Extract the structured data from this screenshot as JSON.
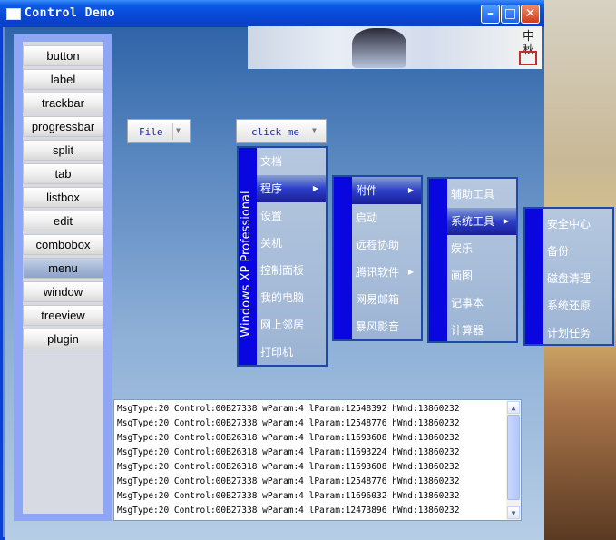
{
  "window": {
    "title": "Control Demo",
    "minimize": "–",
    "maximize": "□",
    "close": "✕"
  },
  "sidebar": {
    "items": [
      {
        "label": "button"
      },
      {
        "label": "label"
      },
      {
        "label": "trackbar"
      },
      {
        "label": "progressbar"
      },
      {
        "label": "split"
      },
      {
        "label": "tab"
      },
      {
        "label": "listbox"
      },
      {
        "label": "edit"
      },
      {
        "label": "combobox"
      },
      {
        "label": "menu"
      },
      {
        "label": "window"
      },
      {
        "label": "treeview"
      },
      {
        "label": "plugin"
      }
    ],
    "active": "menu"
  },
  "banner": {
    "text": "中秋"
  },
  "file_combo": {
    "label": "File",
    "arrow": "▼"
  },
  "click_combo": {
    "label": "click me",
    "arrow": "▼"
  },
  "menus": {
    "main": {
      "side_label": "Windows XP  Professional",
      "items": [
        "文档",
        "程序",
        "设置",
        "关机",
        "控制面板",
        "我的电脑",
        "网上邻居",
        "打印机"
      ],
      "highlighted": "程序"
    },
    "programs": {
      "items": [
        "附件",
        "启动",
        "远程协助",
        "腾讯软件",
        "网易邮箱",
        "暴风影音"
      ],
      "highlighted": "附件"
    },
    "accessories": {
      "items": [
        "辅助工具",
        "系统工具",
        "娱乐",
        "画图",
        "记事本",
        "计算器"
      ],
      "highlighted": "系统工具"
    },
    "system_tools": {
      "items": [
        "安全中心",
        "备份",
        "磁盘清理",
        "系统还原",
        "计划任务"
      ]
    }
  },
  "log": {
    "lines": [
      "MsgType:20 Control:00B27338 wParam:4 lParam:12548392 hWnd:13860232",
      "MsgType:20 Control:00B27338 wParam:4 lParam:12548776 hWnd:13860232",
      "MsgType:20 Control:00B26318 wParam:4 lParam:11693608 hWnd:13860232",
      "MsgType:20 Control:00B26318 wParam:4 lParam:11693224 hWnd:13860232",
      "MsgType:20 Control:00B26318 wParam:4 lParam:11693608 hWnd:13860232",
      "MsgType:20 Control:00B27338 wParam:4 lParam:12548776 hWnd:13860232",
      "MsgType:20 Control:00B27338 wParam:4 lParam:11696032 hWnd:13860232",
      "MsgType:20 Control:00B27338 wParam:4 lParam:12473896 hWnd:13860232"
    ]
  }
}
